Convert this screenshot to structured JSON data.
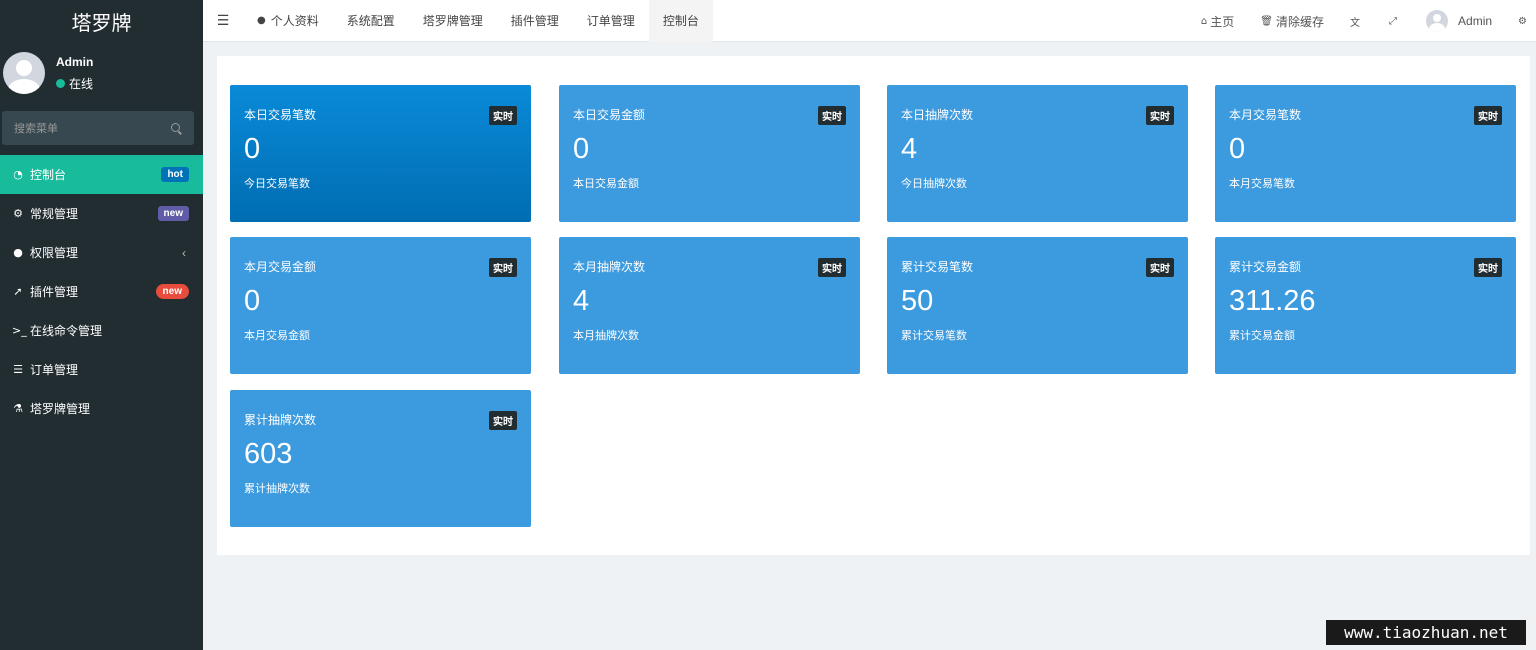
{
  "app": {
    "logo": "塔罗牌"
  },
  "user": {
    "name": "Admin",
    "status": "在线"
  },
  "search": {
    "placeholder": "搜索菜单"
  },
  "sidebar": {
    "items": [
      {
        "label": "控制台",
        "icon": "dashboard-icon",
        "badge": "hot"
      },
      {
        "label": "常规管理",
        "icon": "cogs-icon",
        "badge": "new"
      },
      {
        "label": "权限管理",
        "icon": "users-icon",
        "chevron": "‹"
      },
      {
        "label": "插件管理",
        "icon": "rocket-icon",
        "badge": "new"
      },
      {
        "label": "在线命令管理",
        "icon": "terminal-icon"
      },
      {
        "label": "订单管理",
        "icon": "list-icon"
      },
      {
        "label": "塔罗牌管理",
        "icon": "flask-icon"
      }
    ]
  },
  "topbar": {
    "tabs": [
      "个人资料",
      "系统配置",
      "塔罗牌管理",
      "插件管理",
      "订单管理",
      "控制台"
    ],
    "active_tab": "控制台",
    "home": "主页",
    "clear_cache": "清除缓存",
    "admin": "Admin"
  },
  "cards": [
    {
      "title": "本日交易笔数",
      "badge": "实时",
      "value": "0",
      "sub": "今日交易笔数"
    },
    {
      "title": "本日交易金额",
      "badge": "实时",
      "value": "0",
      "sub": "本日交易金额"
    },
    {
      "title": "本日抽牌次数",
      "badge": "实时",
      "value": "4",
      "sub": "今日抽牌次数"
    },
    {
      "title": "本月交易笔数",
      "badge": "实时",
      "value": "0",
      "sub": "本月交易笔数"
    },
    {
      "title": "本月交易金额",
      "badge": "实时",
      "value": "0",
      "sub": "本月交易金额"
    },
    {
      "title": "本月抽牌次数",
      "badge": "实时",
      "value": "4",
      "sub": "本月抽牌次数"
    },
    {
      "title": "累计交易笔数",
      "badge": "实时",
      "value": "50",
      "sub": "累计交易笔数"
    },
    {
      "title": "累计交易金额",
      "badge": "实时",
      "value": "311.26",
      "sub": "累计交易金额"
    },
    {
      "title": "累计抽牌次数",
      "badge": "实时",
      "value": "603",
      "sub": "累计抽牌次数"
    }
  ],
  "watermark": "www.tiaozhuan.net"
}
